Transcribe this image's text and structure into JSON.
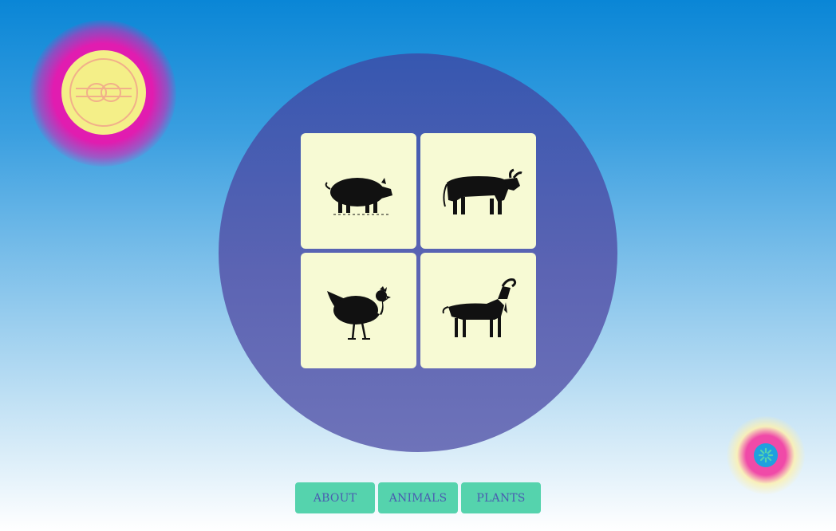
{
  "logo": {
    "icon": "knot-icon",
    "colors": {
      "glow": "#e11cb0",
      "disc": "#f4ef88",
      "line": "#f1b08a"
    }
  },
  "gallery": {
    "cards": [
      {
        "name": "pig",
        "icon": "pig-icon"
      },
      {
        "name": "bull",
        "icon": "bull-icon"
      },
      {
        "name": "hen",
        "icon": "hen-icon"
      },
      {
        "name": "goat",
        "icon": "goat-icon"
      }
    ],
    "colors": {
      "circle": "#4a5cb0",
      "card": "#f7fad4"
    }
  },
  "nav": {
    "about_label": "ABOUT",
    "animals_label": "ANIMALS",
    "plants_label": "PLANTS",
    "colors": {
      "button": "#55d3ad",
      "text": "#4a5cb0"
    }
  },
  "corner_badge": {
    "icon": "flower-icon",
    "colors": {
      "glow": "#f04aa8",
      "disc": "#1fa0df",
      "petal": "#55d3ad"
    }
  }
}
